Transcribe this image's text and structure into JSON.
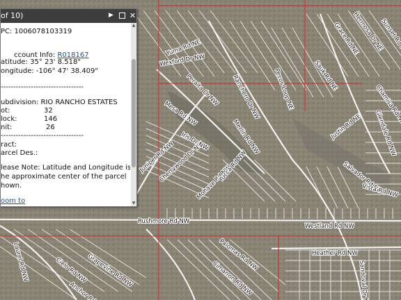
{
  "popup": {
    "count_text": "of 10)",
    "upc": "PC: 1006078103319",
    "account_label": "ccount Info: ",
    "account_link": "R018167",
    "latitude": "atitude: 35° 23' 8.518\"",
    "longitude": "ongitude: -106° 47' 38.409\"",
    "separator1": "---------------------------------",
    "subdivision": "ubdivision: RIO RANCHO ESTATES",
    "lot_label": "ot:",
    "lot_value": "32",
    "block_label": "lock:",
    "block_value": "146",
    "unit_label": "nit:",
    "unit_value": "26",
    "separator2": "---------------------------------",
    "tract": "ract:",
    "parcel_des": "arcel Des.:",
    "note_line1": "lease Note: Latitude and Longitude is",
    "note_line2": "he approximate center of the parcel",
    "note_line3": "hown.",
    "zoom_link": "oom to"
  },
  "map_labels": [
    {
      "id": "rushmore-rd",
      "text": "Rushmore Rd NW"
    },
    {
      "id": "westland-rd",
      "text": "Westland Rd NW"
    },
    {
      "id": "heather-rd",
      "text": "Heather Rd NW"
    },
    {
      "id": "ranchero-dr",
      "text": "Ranchero Dr NW"
    },
    {
      "id": "pecos-loop",
      "text": "Pecos Loop NE"
    },
    {
      "id": "merlin-rd",
      "text": "Merlin Rd NW"
    },
    {
      "id": "wexford-dr",
      "text": "Wexford Dr NW"
    },
    {
      "id": "cherrywood-dr",
      "text": "Cherrywood Dr NW"
    },
    {
      "id": "mohave-rd",
      "text": "Mohave Rd NW"
    },
    {
      "id": "juniper-rd",
      "text": "Juniper Rd NW"
    },
    {
      "id": "salvador-rd",
      "text": "Salvador Rd NE"
    },
    {
      "id": "justin-rd",
      "text": "Justin Rd NE"
    },
    {
      "id": "chamisa-rd",
      "text": "Chamisa Rd NE"
    },
    {
      "id": "sauk-rd",
      "text": "Sauk Rd NE"
    },
    {
      "id": "grace-rd",
      "text": "Grace Rd NE"
    },
    {
      "id": "hermosa-dr",
      "text": "Hermosa Dr NE"
    },
    {
      "id": "sunset-rd",
      "text": "Sunset Rd NE"
    },
    {
      "id": "yuma-rd",
      "text": "Yuma Rd NE"
    },
    {
      "id": "peralta-dr",
      "text": "Peralta Dr NW"
    },
    {
      "id": "mesa-rd",
      "text": "Mesa Rd NW"
    },
    {
      "id": "palomas-rd",
      "text": "Palomas Rd NW"
    },
    {
      "id": "sandoval-dr",
      "text": "Sandoval Dr NW"
    },
    {
      "id": "grapevine-rd",
      "text": "Grapevine Rd NW"
    },
    {
      "id": "laurel-rd",
      "text": "Laurel Rd NW"
    },
    {
      "id": "cielo-rd",
      "text": "Cielo Rd NW"
    },
    {
      "id": "cimarron-rd",
      "text": "Cimarron Rd NW"
    },
    {
      "id": "anchor-rd",
      "text": "Anchor Rd NW"
    },
    {
      "id": "glendale-rd",
      "text": "Glendale Rd NW"
    },
    {
      "id": "yucca-rd",
      "text": "Yucca Rd NW"
    },
    {
      "id": "vista-rd",
      "text": "Vista Rd NW"
    },
    {
      "id": "iris-dr",
      "text": "Iris Dr NW"
    }
  ],
  "colors": {
    "parcel_lines": "#e8e8e8",
    "boundary_lines": "#d62828",
    "road_labels": "#111111",
    "popup_header": "#3d3d3d",
    "link": "#1f4e9c"
  },
  "icons": {
    "next": "play-triangle",
    "maximize": "window-square",
    "close": "x-mark"
  }
}
